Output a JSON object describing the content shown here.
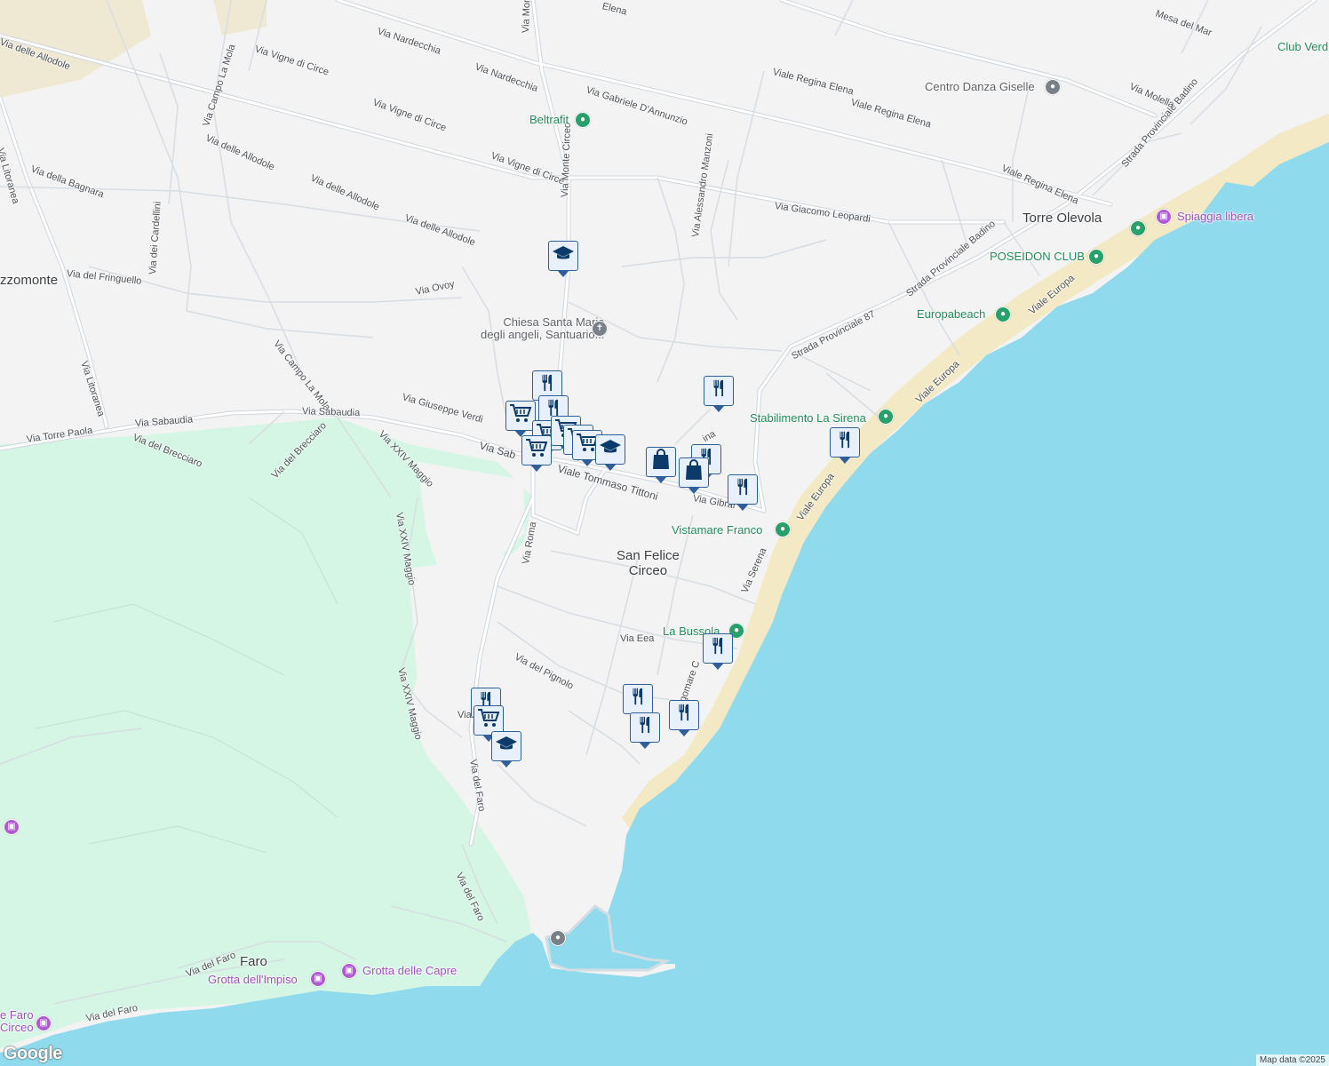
{
  "map": {
    "attribution": "Map data ©2025",
    "logo": "Google",
    "colors": {
      "land": "#f3f3f4",
      "water": "#8fdaed",
      "park": "#d5f6e5",
      "sand": "#f3e9c4",
      "road": "#ffffff",
      "road_outline": "#cbd2da",
      "marker_border": "#2f5f9a",
      "marker_fill": "#e8f0fb"
    }
  },
  "places": {
    "san_felice_circeo": "San Felice\nCirceo",
    "torre_olevola": "Torre Olevola",
    "faro": "Faro",
    "mezzomonte": "zzomonte"
  },
  "streets": {
    "s1": "Via delle Allodole",
    "s2": "Via Nardecchia",
    "s3": "Via Nardecchia",
    "s4": "Via Vigne di Circe",
    "s5": "Via Campo La Mola",
    "s6": "Via Vigne di Circe",
    "s7": "Via Vigne di Circe",
    "s8": "Via delle Allodole",
    "s9": "Via delle Allodole",
    "s10": "Via delle Allodole",
    "s11": "Via Litoranea",
    "s12": "Via della Bagnara",
    "s13": "Via dei Cardellini",
    "s14": "Via del Fringuello",
    "s15": "Via Ovoy",
    "s16": "Via Campo La Mola",
    "s17": "Via Giuseppe Verdi",
    "s18": "Via Litoranea",
    "s19": "Via Sabaudia",
    "s20": "Via Sabaudia",
    "s21": "Via Torre Paola",
    "s22": "Via del Brecciaro",
    "s23": "Via del Brecciaro",
    "s24": "Via XXIV Maggio",
    "s25": "Via XXIV Maggio",
    "s26": "Via XXIV Maggio",
    "s27": "Via Monte Circeo",
    "s28": "Via Monte C",
    "s29": "Via Gabriele D'Annunzio",
    "s30": "Viale Regina Elena",
    "s31": "Viale Regina Elena",
    "s32": "Viale Regina Elena",
    "s33": "Via Alessandro Manzoni",
    "s34": "Via Giacomo Leopardi",
    "s35": "Strada Provinciale 87",
    "s36": "Strada Provinciale Badino",
    "s37": "Strada Provinciale Badino",
    "s38": "Viale Europa",
    "s39": "Viale Europa",
    "s40": "Viale Europa",
    "s41": "Via Molella",
    "s42": "Mesa del Mar",
    "s43": "Elena",
    "s44": "Viale Tommaso Tittoni",
    "s45": "Via Roma",
    "s46": "Via Gibral",
    "s47": "Via Serena",
    "s48": "Via Eea",
    "s49": "Via del Pignolo",
    "s50": "Via del Faro",
    "s51": "Via del Faro",
    "s52": "Via del Faro",
    "s53": "Via del Faro",
    "s54": "Lungomare C",
    "s55": "Via Sab",
    "s56": "Via",
    "s57": "ina"
  },
  "pois": {
    "beltrafit": "Beltrafit",
    "centro_danza": "Centro Danza Giselle",
    "club_verde": "Club Verd",
    "spiaggia_libera": "Spiaggia libera",
    "poseidon": "POSEIDON CLUB",
    "europabeach": "Europabeach",
    "la_sirena": "Stabilimento La Sirena",
    "vistamare": "Vistamare Franco",
    "la_bussola": "La Bussola",
    "chiesa": "Chiesa Santa Maria\ndegli angeli, Santuario...",
    "grotta_impiso": "Grotta dell'Impiso",
    "grotta_capre": "Grotta delle Capre",
    "faro_circeo": "e Faro\nCirceo"
  },
  "markers": [
    {
      "type": "school-icon"
    },
    {
      "type": "restaurant-icon"
    },
    {
      "type": "restaurant-icon"
    },
    {
      "type": "cart-icon"
    },
    {
      "type": "cart-icon"
    },
    {
      "type": "cart-icon"
    },
    {
      "type": "cart-icon"
    },
    {
      "type": "cart-icon"
    },
    {
      "type": "cart-icon"
    },
    {
      "type": "school-icon"
    },
    {
      "type": "restaurant-icon"
    },
    {
      "type": "shopping-bag-icon"
    },
    {
      "type": "restaurant-icon"
    },
    {
      "type": "shopping-bag-icon"
    },
    {
      "type": "restaurant-icon"
    },
    {
      "type": "restaurant-icon"
    },
    {
      "type": "restaurant-icon"
    },
    {
      "type": "restaurant-icon"
    },
    {
      "type": "restaurant-icon"
    },
    {
      "type": "restaurant-icon"
    },
    {
      "type": "restaurant-icon"
    },
    {
      "type": "cart-icon"
    },
    {
      "type": "school-icon"
    }
  ]
}
